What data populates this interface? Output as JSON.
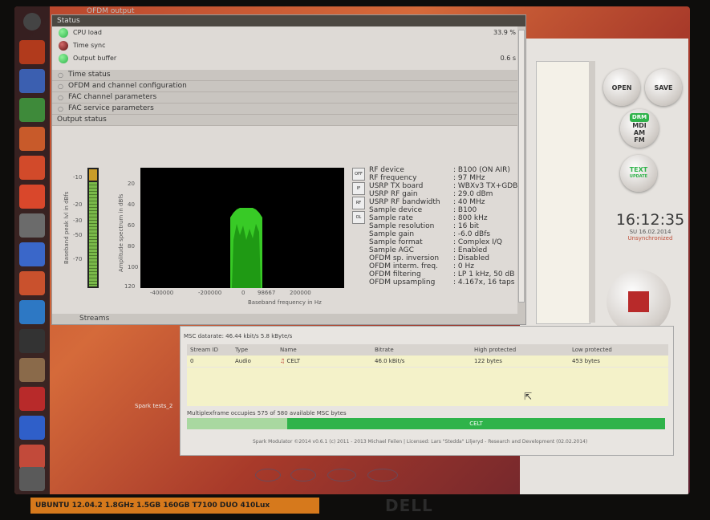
{
  "window_title": "OFDM output",
  "status": {
    "title": "Status",
    "rows": [
      {
        "label": "CPU load",
        "value": "33.9 %",
        "led": "#2fb34a"
      },
      {
        "label": "Time sync",
        "value": "",
        "led": "#8a1e1e"
      },
      {
        "label": "Output buffer",
        "value": "0.6 s",
        "led": "#2fb34a"
      }
    ]
  },
  "sections": [
    "Time status",
    "OFDM and channel configuration",
    "FAC channel parameters",
    "FAC service parameters"
  ],
  "output_status": {
    "title": "Output status",
    "meter_ylabel": "Baseband peak lvl in dBfs",
    "meter_ticks": [
      "-10",
      "-20",
      "-30",
      "-50",
      "-70"
    ],
    "spec_ylabel": "Amplitude spectrum in dBfs",
    "spec_yticks": [
      "20",
      "40",
      "60",
      "80",
      "100",
      "120"
    ],
    "spec_xticks": [
      "-400000",
      "-200000",
      "0",
      "98667",
      "200000"
    ],
    "spec_xlabel": "Baseband frequency in Hz",
    "side_buttons": [
      "OFF",
      "IF",
      "RF",
      "OL"
    ],
    "info": [
      {
        "k": "RF device",
        "v": ": B100 (ON AIR)"
      },
      {
        "k": "RF frequency",
        "v": ": 97 MHz"
      },
      {
        "k": "USRP TX board",
        "v": ": WBXv3 TX+GDB"
      },
      {
        "k": "USRP RF gain",
        "v": ": 29.0 dBm"
      },
      {
        "k": "USRP RF bandwidth",
        "v": ": 40 MHz"
      },
      {
        "k": "Sample device",
        "v": ": B100"
      },
      {
        "k": "Sample rate",
        "v": ": 800 kHz"
      },
      {
        "k": "Sample resolution",
        "v": ": 16 bit"
      },
      {
        "k": "Sample gain",
        "v": ": -6.0 dBfs"
      },
      {
        "k": "Sample format",
        "v": ": Complex I/Q"
      },
      {
        "k": "Sample AGC",
        "v": ": Enabled"
      },
      {
        "k": "OFDM sp. inversion",
        "v": ": Disabled"
      },
      {
        "k": "OFDM interm. freq.",
        "v": ": 0 Hz"
      },
      {
        "k": "OFDM filtering",
        "v": ": LP 1 kHz, 50 dB"
      },
      {
        "k": "OFDM upsampling",
        "v": ": 4.167x, 16 taps"
      }
    ],
    "streams_label": "Streams"
  },
  "right_panel": {
    "open": "OPEN",
    "save": "SAVE",
    "modes": [
      "DRM",
      "MDI",
      "AM",
      "FM"
    ],
    "text_btn": "TEXT",
    "text_sub": "UPDATE",
    "time": "16:12:35",
    "date": "SU 16.02.2014",
    "sync": "Unsynchronized"
  },
  "streams": {
    "datarate": "MSC datarate: 46.44 kbit/s  5.8 kByte/s",
    "headers": [
      "Stream ID",
      "Type",
      "Name",
      "Bitrate",
      "High protected",
      "Low protected"
    ],
    "rows": [
      {
        "id": "0",
        "type": "Audio",
        "name": "CELT",
        "bitrate": "46.0 kBit/s",
        "high": "122 bytes",
        "low": "453 bytes"
      }
    ],
    "multiplex_text": "Multiplexframe occupies 575 of 580 available MSC bytes",
    "bar_label": "CELT",
    "bar_fraction": 0.79,
    "credits": "Spark Modulator ©2014 v0.6.1 (c) 2011 - 2013 Michael Feilen | Licensed: Lars \"Stedda\" Liljeryd - Research and Development (02.02.2014)"
  },
  "desktop_label": "Spark tests_2",
  "sticker": "UBUNTU 12.04.2  1.8GHz  1.5GB  160GB  T7100  DUO  410Lux",
  "brand": "DELL",
  "colors": {
    "accent": "#2fb34a",
    "spectrum": "#3ee02a",
    "stop": "#b82a2a"
  }
}
